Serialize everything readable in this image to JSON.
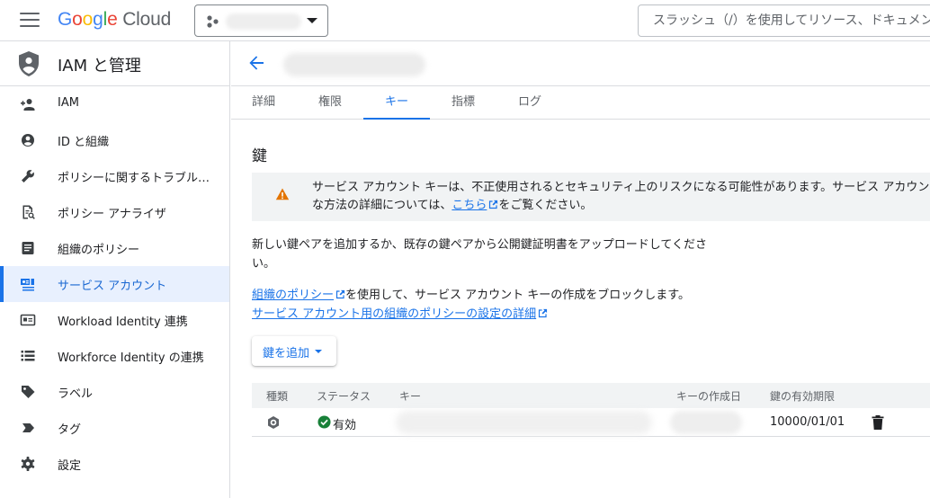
{
  "header": {
    "logo_google": [
      "G",
      "o",
      "o",
      "g",
      "l",
      "e"
    ],
    "logo_cloud": "Cloud",
    "search_placeholder": "スラッシュ（/）を使用してリソース、ドキュメント、プロダクトなどを検索"
  },
  "sidebar": {
    "title": "IAM と管理",
    "items": [
      {
        "label": "IAM",
        "icon": "person-add-icon"
      },
      {
        "label": "ID と組織",
        "icon": "account-circle-icon"
      },
      {
        "label": "ポリシーに関するトラブル…",
        "icon": "wrench-icon"
      },
      {
        "label": "ポリシー アナライザ",
        "icon": "policy-analyzer-icon"
      },
      {
        "label": "組織のポリシー",
        "icon": "document-icon"
      },
      {
        "label": "サービス アカウント",
        "icon": "service-account-icon"
      },
      {
        "label": "Workload Identity 連携",
        "icon": "id-card-icon"
      },
      {
        "label": "Workforce Identity の連携",
        "icon": "list-icon"
      },
      {
        "label": "ラベル",
        "icon": "label-icon"
      },
      {
        "label": "タグ",
        "icon": "tag-icon"
      },
      {
        "label": "設定",
        "icon": "gear-icon"
      }
    ],
    "active_index": 5
  },
  "tabs": [
    "詳細",
    "権限",
    "キー",
    "指標",
    "ログ"
  ],
  "active_tab": 2,
  "section_title": "鍵",
  "warning": {
    "line1": "サービス アカウント キーは、不正使用されるとセキュリティ上のリスクになる可能性があります。サービス アカウン",
    "line2_before": "な方法の詳細については、",
    "line2_link": "こちら",
    "line2_after": "をご覧ください。"
  },
  "description": "新しい鍵ペアを追加するか、既存の鍵ペアから公開鍵証明書をアップロードしてください。",
  "policy_link": "組織のポリシー",
  "policy_text": "を使用して、サービス アカウント キーの作成をブロックします。",
  "policy_details_link": "サービス アカウント用の組織のポリシーの設定の詳細",
  "add_key_label": "鍵を追加",
  "table": {
    "headers": [
      "種類",
      "ステータス",
      "キー",
      "キーの作成日",
      "鍵の有効期限"
    ],
    "rows": [
      {
        "status": "有効",
        "expiry": "10000/01/01"
      }
    ]
  },
  "colors": {
    "accent": "#1a73e8",
    "warning": "#e37400",
    "success": "#188038"
  }
}
